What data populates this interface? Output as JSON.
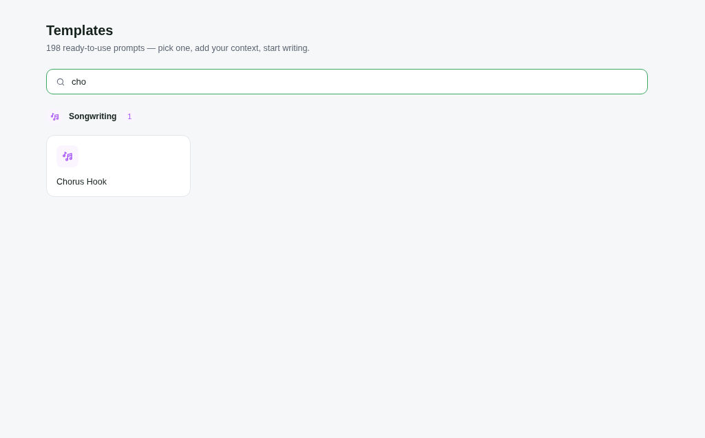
{
  "header": {
    "title": "Templates",
    "subtitle": "198 ready-to-use prompts — pick one, add your context, start writing."
  },
  "search": {
    "value": "cho",
    "focused": true
  },
  "groups": [
    {
      "name": "Songwriting",
      "count": "1",
      "templates": [
        {
          "title": "Chorus Hook"
        }
      ]
    }
  ]
}
